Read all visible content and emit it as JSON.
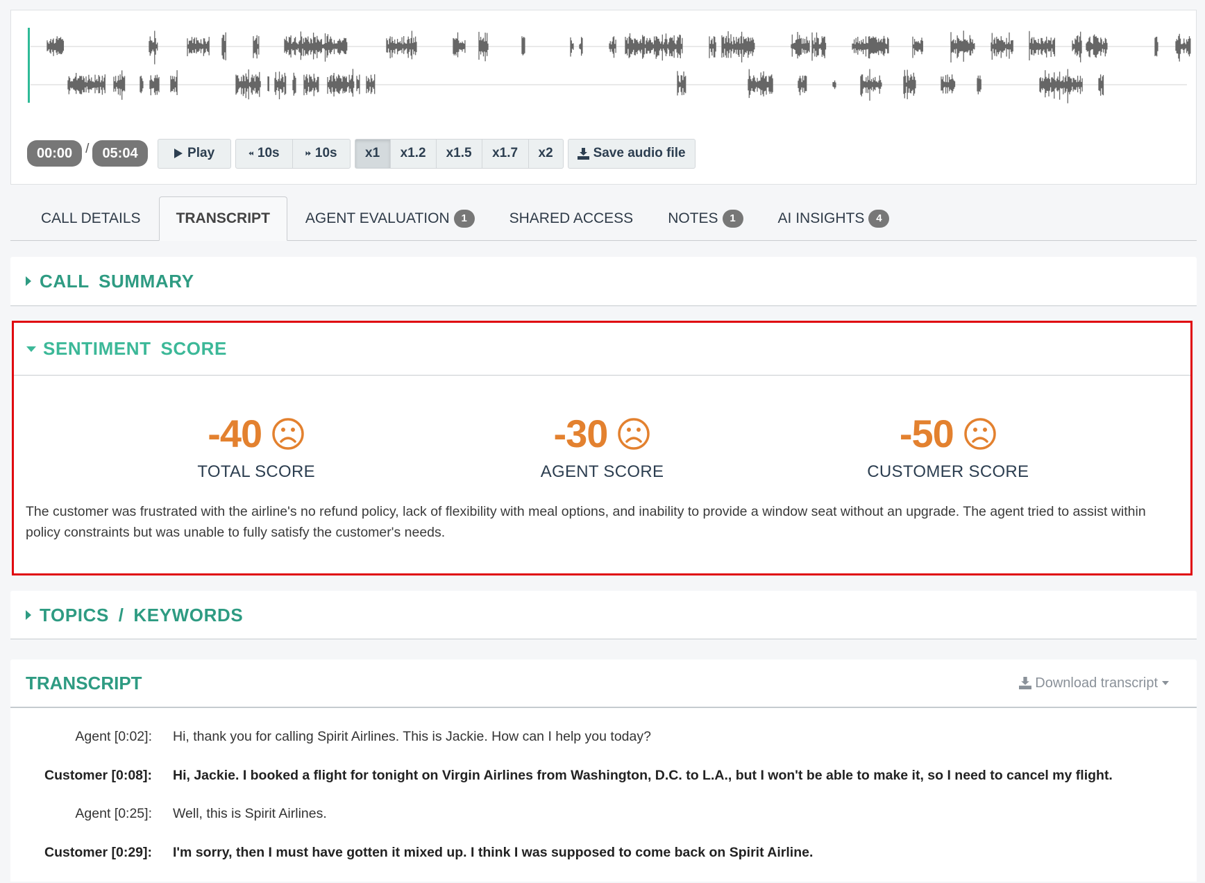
{
  "player": {
    "current_time": "00:00",
    "separator": "/",
    "duration": "05:04",
    "play_label": "Play",
    "rewind_label": "10s",
    "forward_label": "10s",
    "speeds": [
      "x1",
      "x1.2",
      "x1.5",
      "x1.7",
      "x2"
    ],
    "active_speed": "x1",
    "save_label": "Save audio file"
  },
  "tabs": [
    {
      "label": "CALL DETAILS",
      "badge": null,
      "active": false
    },
    {
      "label": "TRANSCRIPT",
      "badge": null,
      "active": true
    },
    {
      "label": "AGENT EVALUATION",
      "badge": "1",
      "active": false
    },
    {
      "label": "SHARED ACCESS",
      "badge": null,
      "active": false
    },
    {
      "label": "NOTES",
      "badge": "1",
      "active": false
    },
    {
      "label": "AI INSIGHTS",
      "badge": "4",
      "active": false
    }
  ],
  "sections": {
    "call_summary": {
      "title": "CALL SUMMARY",
      "expanded": false
    },
    "sentiment": {
      "title": "SENTIMENT SCORE",
      "expanded": true,
      "scores": [
        {
          "value": "-40",
          "label": "TOTAL SCORE",
          "icon": "sad-face-icon"
        },
        {
          "value": "-30",
          "label": "AGENT SCORE",
          "icon": "sad-face-icon"
        },
        {
          "value": "-50",
          "label": "CUSTOMER SCORE",
          "icon": "sad-face-icon"
        }
      ],
      "summary": "The customer was frustrated with the airline's no refund policy, lack of flexibility with meal options, and inability to provide a window seat without an upgrade. The agent tried to assist within policy constraints but was unable to fully satisfy the customer's needs."
    },
    "topics": {
      "title": "TOPICS / KEYWORDS",
      "expanded": false
    }
  },
  "transcript": {
    "title": "TRANSCRIPT",
    "download_label": "Download transcript",
    "lines": [
      {
        "speaker": "Agent [0:02]:",
        "role": "agent",
        "text": "Hi, thank you for calling Spirit Airlines. This is Jackie. How can I help you today?"
      },
      {
        "speaker": "Customer [0:08]:",
        "role": "customer",
        "text": "Hi, Jackie. I booked a flight for tonight on Virgin Airlines from Washington, D.C. to L.A., but I won't be able to make it, so I need to cancel my flight."
      },
      {
        "speaker": "Agent [0:25]:",
        "role": "agent",
        "text": "Well, this is Spirit Airlines."
      },
      {
        "speaker": "Customer [0:29]:",
        "role": "customer",
        "text": "I'm sorry, then I must have gotten it mixed up. I think I was supposed to come back on Spirit Airline."
      }
    ]
  },
  "colors": {
    "accent": "#2e9b82",
    "score": "#e3812f",
    "highlight_border": "#e0060f",
    "cursor": "#2fba97"
  }
}
